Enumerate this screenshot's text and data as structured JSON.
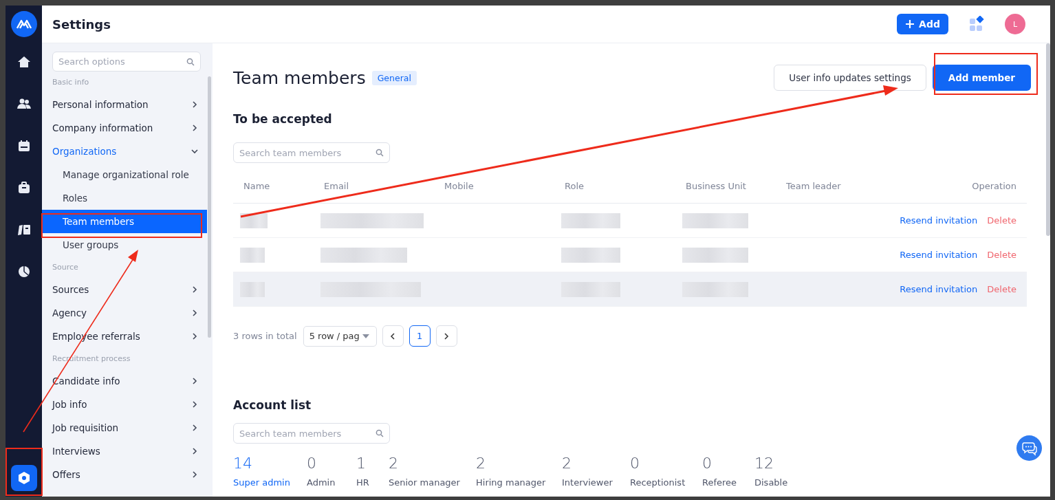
{
  "header": {
    "title": "Settings",
    "add_button": "Add",
    "avatar": "L"
  },
  "sidebar": {
    "search": {
      "placeholder": "Search options"
    },
    "sections": [
      {
        "heading": "Basic info",
        "items": [
          {
            "label": "Personal information",
            "expanded": false,
            "selected": false
          },
          {
            "label": "Company information",
            "expanded": false,
            "selected": false
          },
          {
            "label": "Organizations",
            "expanded": true,
            "selected": true,
            "children": [
              {
                "label": "Manage organizational role",
                "selected": false
              },
              {
                "label": "Roles",
                "selected": false
              },
              {
                "label": "Team members",
                "selected": true
              },
              {
                "label": "User groups",
                "selected": false
              }
            ]
          }
        ]
      },
      {
        "heading": "Source",
        "items": [
          {
            "label": "Sources",
            "expanded": false,
            "selected": false
          },
          {
            "label": "Agency",
            "expanded": false,
            "selected": false
          },
          {
            "label": "Employee referrals",
            "expanded": false,
            "selected": false
          }
        ]
      },
      {
        "heading": "Recruitment process",
        "items": [
          {
            "label": "Candidate info",
            "expanded": false,
            "selected": false
          },
          {
            "label": "Job info",
            "expanded": false,
            "selected": false
          },
          {
            "label": "Job requisition",
            "expanded": false,
            "selected": false
          },
          {
            "label": "Interviews",
            "expanded": false,
            "selected": false
          },
          {
            "label": "Offers",
            "expanded": false,
            "selected": false
          }
        ]
      }
    ]
  },
  "page": {
    "title": "Team members",
    "tag": "General",
    "buttons": [
      "User info updates settings",
      "Add member"
    ]
  },
  "pending": {
    "title": "To be accepted",
    "search": {
      "placeholder": "Search team members"
    },
    "columns": [
      "Name",
      "Email",
      "Mobile",
      "Role",
      "Business Unit",
      "Team leader",
      "Operation"
    ],
    "rows": [
      {
        "hovered": false,
        "actions": [
          "Resend invitation",
          "Delete"
        ]
      },
      {
        "hovered": false,
        "actions": [
          "Resend invitation",
          "Delete"
        ]
      },
      {
        "hovered": true,
        "actions": [
          "Resend invitation",
          "Delete"
        ]
      }
    ],
    "pagination": {
      "total": "3 rows in total",
      "page_size": "5 row / pag",
      "pages": [
        {
          "label": "1",
          "selected": true
        }
      ]
    }
  },
  "accounts": {
    "title": "Account list",
    "search": {
      "placeholder": "Search team members"
    },
    "stats": [
      {
        "value": "14",
        "label": "Super admin",
        "selected": true
      },
      {
        "value": "0",
        "label": "Admin",
        "selected": false
      },
      {
        "value": "1",
        "label": "HR",
        "selected": false
      },
      {
        "value": "2",
        "label": "Senior manager",
        "selected": false
      },
      {
        "value": "2",
        "label": "Hiring manager",
        "selected": false
      },
      {
        "value": "2",
        "label": "Interviewer",
        "selected": false
      },
      {
        "value": "0",
        "label": "Receptionist",
        "selected": false
      },
      {
        "value": "0",
        "label": "Referee",
        "selected": false
      },
      {
        "value": "12",
        "label": "Disable",
        "selected": false
      }
    ]
  }
}
